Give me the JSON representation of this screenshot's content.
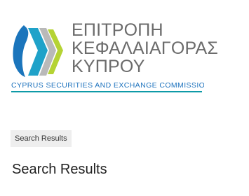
{
  "logo": {
    "line1": "ΕΠΙΤΡΟΠΗ",
    "line2": "ΚΕΦΑΛΑΙΑΓΟΡΑΣ",
    "line3": "ΚΥΠΡΟΥ",
    "subtitle": "CYPRUS SECURITIES AND EXCHANGE COMMISSION",
    "colors": {
      "text": "#6b6b6b",
      "subtitle": "#1e73be",
      "underline": "#0e9aa7",
      "mark_blue": "#1b75bc",
      "mark_teal": "#1fa2c9",
      "mark_gray": "#b9b9b9",
      "mark_lime": "#b5d334"
    }
  },
  "breadcrumb": {
    "current": "Search Results"
  },
  "main": {
    "title": "Search Results"
  }
}
